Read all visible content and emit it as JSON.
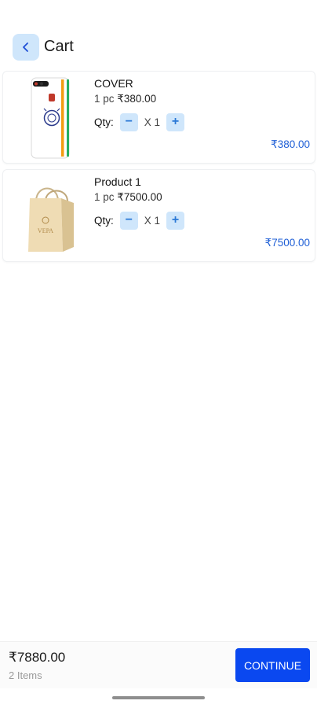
{
  "header": {
    "back_icon": "chevron-left-icon",
    "title": "Cart"
  },
  "cart": {
    "items": [
      {
        "name": "COVER",
        "unit": "1 pc",
        "price": "₹380.00",
        "qty_label": "Qty:",
        "minus": "−",
        "qty": "X 1",
        "plus": "+",
        "line_total": "₹380.00",
        "image": "phone-cover-image"
      },
      {
        "name": "Product 1",
        "unit": "1 pc",
        "price": "₹7500.00",
        "qty_label": "Qty:",
        "minus": "−",
        "qty": "X 1",
        "plus": "+",
        "line_total": "₹7500.00",
        "image": "shopping-bag-image",
        "image_text": "VEPA"
      }
    ]
  },
  "footer": {
    "total": "₹7880.00",
    "count": "2 Items",
    "continue_label": "CONTINUE"
  },
  "colors": {
    "accent": "#0a48f0",
    "price": "#1f5fd6",
    "stepper_bg": "#cfe6fb"
  }
}
